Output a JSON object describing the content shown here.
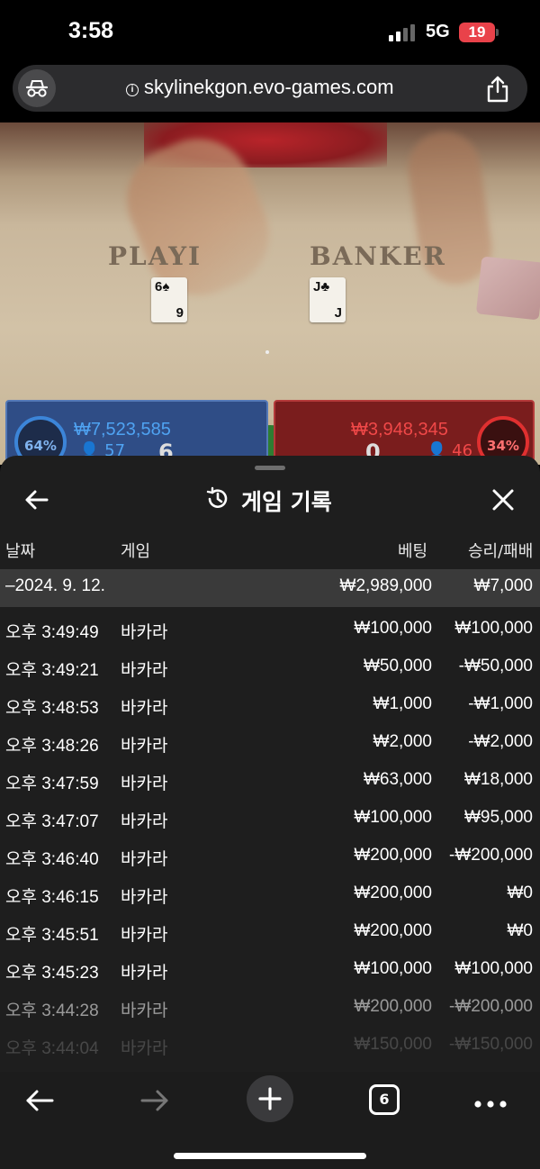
{
  "status_bar": {
    "time": "3:58",
    "network": "5G",
    "battery": "19"
  },
  "browser": {
    "url": "skylinekgon.evo-games.com",
    "open_tabs": "6"
  },
  "game": {
    "player_label": "PLAYI",
    "banker_label": "BANKER",
    "player_card": {
      "rank_top": "6",
      "rank_bottom": "9",
      "suit": "♠"
    },
    "banker_card": {
      "rank_top": "J",
      "rank_bottom": "J",
      "suit": "♣"
    },
    "player_bet": {
      "percent": "64%",
      "amount": "₩7,523,585",
      "bettors": "57",
      "score": "6"
    },
    "banker_bet": {
      "percent": "34%",
      "amount": "₩3,948,345",
      "bettors": "46",
      "score": "0"
    }
  },
  "history": {
    "title": "게임 기록",
    "columns": {
      "date": "날짜",
      "game": "게임",
      "bet": "베팅",
      "win_loss": "승리/패배"
    },
    "summary": {
      "date": "–2024. 9. 12.",
      "bet": "₩2,989,000",
      "win_loss": "₩7,000"
    },
    "rows": [
      {
        "time": "오후 3:49:49",
        "game": "바카라",
        "bet": "₩100,000",
        "win_loss": "₩100,000"
      },
      {
        "time": "오후 3:49:21",
        "game": "바카라",
        "bet": "₩50,000",
        "win_loss": "-₩50,000"
      },
      {
        "time": "오후 3:48:53",
        "game": "바카라",
        "bet": "₩1,000",
        "win_loss": "-₩1,000"
      },
      {
        "time": "오후 3:48:26",
        "game": "바카라",
        "bet": "₩2,000",
        "win_loss": "-₩2,000"
      },
      {
        "time": "오후 3:47:59",
        "game": "바카라",
        "bet": "₩63,000",
        "win_loss": "₩18,000"
      },
      {
        "time": "오후 3:47:07",
        "game": "바카라",
        "bet": "₩100,000",
        "win_loss": "₩95,000"
      },
      {
        "time": "오후 3:46:40",
        "game": "바카라",
        "bet": "₩200,000",
        "win_loss": "-₩200,000"
      },
      {
        "time": "오후 3:46:15",
        "game": "바카라",
        "bet": "₩200,000",
        "win_loss": "₩0"
      },
      {
        "time": "오후 3:45:51",
        "game": "바카라",
        "bet": "₩200,000",
        "win_loss": "₩0"
      },
      {
        "time": "오후 3:45:23",
        "game": "바카라",
        "bet": "₩100,000",
        "win_loss": "₩100,000"
      },
      {
        "time": "오후 3:44:28",
        "game": "바카라",
        "bet": "₩200,000",
        "win_loss": "-₩200,000"
      },
      {
        "time": "오후 3:44:04",
        "game": "바카라",
        "bet": "₩150,000",
        "win_loss": "-₩150,000"
      }
    ]
  },
  "colors": {
    "player_blue": "#2f4d86",
    "banker_red": "#7a1d1d",
    "sheet_bg": "#1e1e1e",
    "summary_bg": "#3a3a3a"
  }
}
